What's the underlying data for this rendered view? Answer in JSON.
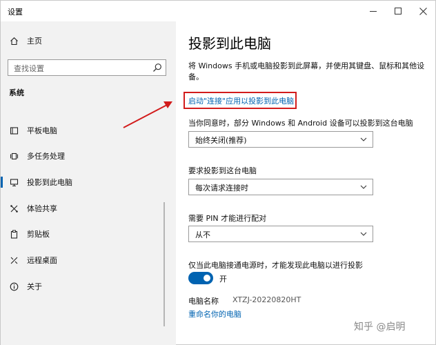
{
  "window": {
    "title": "设置"
  },
  "sidebar": {
    "home_label": "主页",
    "search_placeholder": "查找设置",
    "section_label": "系统",
    "items": [
      {
        "label": "平板电脑",
        "icon": "tablet-icon"
      },
      {
        "label": "多任务处理",
        "icon": "multitasking-icon"
      },
      {
        "label": "投影到此电脑",
        "icon": "project-icon",
        "active": true
      },
      {
        "label": "体验共享",
        "icon": "shared-experience-icon"
      },
      {
        "label": "剪贴板",
        "icon": "clipboard-icon"
      },
      {
        "label": "远程桌面",
        "icon": "remote-desktop-icon"
      },
      {
        "label": "关于",
        "icon": "info-icon"
      }
    ]
  },
  "main": {
    "title": "投影到此电脑",
    "description": "将 Windows 手机或电脑投影到此屏幕，并使用其键盘、鼠标和其他设备。",
    "launch_link": "启动\"连接\"应用以投影到此电脑",
    "settings": [
      {
        "label": "当你同意时，部分 Windows 和 Android 设备可以投影到这台电脑",
        "value": "始终关闭(推荐)"
      },
      {
        "label": "要求投影到这台电脑",
        "value": "每次请求连接时"
      },
      {
        "label": "需要 PIN 才能进行配对",
        "value": "从不"
      }
    ],
    "power_label": "仅当此电脑接通电源时，才能发现此电脑以进行投影",
    "toggle_state": "开",
    "pc_name_label": "电脑名称",
    "pc_name_value": "XTZJ-20220820HT",
    "rename_link": "重命名你的电脑"
  },
  "watermark": "知乎 @启明",
  "colors": {
    "accent": "#0063b1",
    "highlight": "#d21b1b",
    "sidebar_bg": "#f2f2f2"
  }
}
